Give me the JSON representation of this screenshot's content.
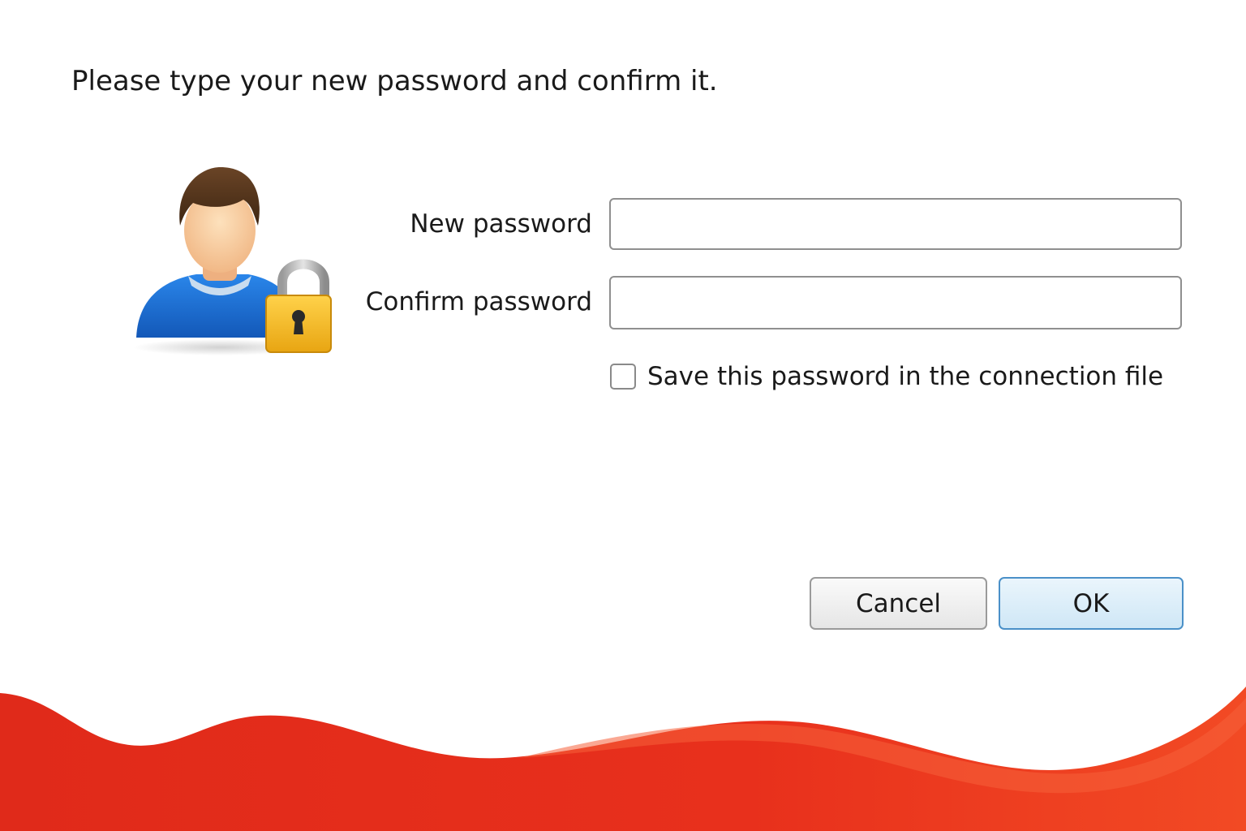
{
  "dialog": {
    "instruction": "Please type your new password and confirm it.",
    "fields": {
      "new_password_label": "New password",
      "new_password_value": "",
      "confirm_password_label": "Confirm password",
      "confirm_password_value": ""
    },
    "save_checkbox": {
      "label": "Save this password in the connection file",
      "checked": false
    },
    "buttons": {
      "cancel_label": "Cancel",
      "ok_label": "OK"
    },
    "icon": "user-with-padlock-icon"
  },
  "colors": {
    "accent_red": "#e02a1a",
    "ok_border": "#4a90c8",
    "ok_fill": "#d8edf9",
    "user_shirt": "#1f6fd4",
    "padlock_gold": "#f2b51c"
  }
}
